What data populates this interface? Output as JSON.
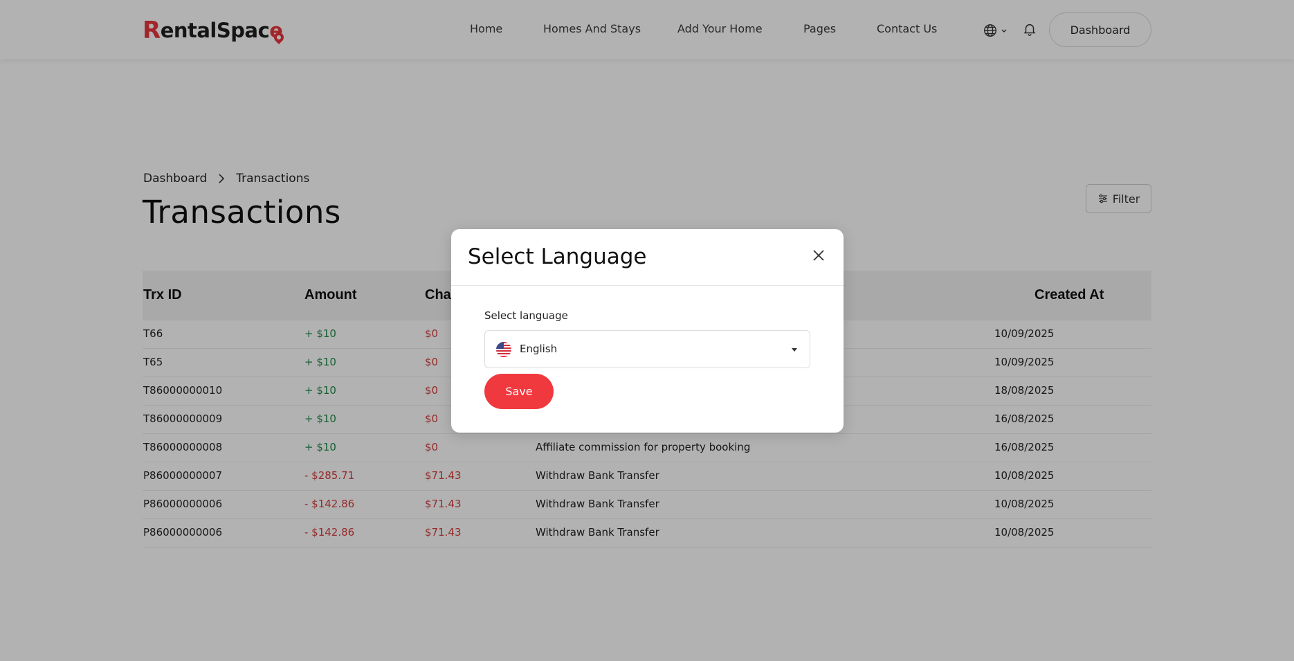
{
  "header": {
    "logo_first": "R",
    "logo_rest": "entalSpac",
    "logo_last": "e",
    "nav": [
      "Home",
      "Homes And Stays",
      "Add Your Home",
      "Pages",
      "Contact Us"
    ],
    "dashboard_label": "Dashboard"
  },
  "breadcrumb": {
    "root": "Dashboard",
    "current": "Transactions"
  },
  "page": {
    "title": "Transactions",
    "filter_label": "Filter"
  },
  "table": {
    "headers": {
      "trx_id": "Trx ID",
      "amount": "Amount",
      "charge": "Cha",
      "created_at": "Created At"
    },
    "rows": [
      {
        "trx": "T66",
        "amount": "+ $10",
        "amount_type": "credit",
        "charge": "$0",
        "detail": "",
        "date": "10/09/2025"
      },
      {
        "trx": "T65",
        "amount": "+ $10",
        "amount_type": "credit",
        "charge": "$0",
        "detail": "",
        "date": "10/09/2025"
      },
      {
        "trx": "T86000000010",
        "amount": "+ $10",
        "amount_type": "credit",
        "charge": "$0",
        "detail": "",
        "date": "18/08/2025"
      },
      {
        "trx": "T86000000009",
        "amount": "+ $10",
        "amount_type": "credit",
        "charge": "$0",
        "detail": "",
        "date": "16/08/2025"
      },
      {
        "trx": "T86000000008",
        "amount": "+ $10",
        "amount_type": "credit",
        "charge": "$0",
        "detail": "Affiliate commission for property booking",
        "date": "16/08/2025"
      },
      {
        "trx": "P86000000007",
        "amount": "- $285.71",
        "amount_type": "debit",
        "charge": "$71.43",
        "detail": "Withdraw Bank Transfer",
        "date": "10/08/2025"
      },
      {
        "trx": "P86000000006",
        "amount": "- $142.86",
        "amount_type": "debit",
        "charge": "$71.43",
        "detail": "Withdraw Bank Transfer",
        "date": "10/08/2025"
      },
      {
        "trx": "P86000000006",
        "amount": "- $142.86",
        "amount_type": "debit",
        "charge": "$71.43",
        "detail": "Withdraw Bank Transfer",
        "date": "10/08/2025"
      }
    ]
  },
  "modal": {
    "title": "Select Language",
    "field_label": "Select language",
    "selected_language": "English",
    "save_label": "Save"
  },
  "colors": {
    "accent": "#f0393f",
    "credit": "#1e8a4a",
    "debit": "#d63c3c"
  },
  "icons": {
    "language": "globe-icon",
    "notifications": "bell-icon",
    "filter": "sliders-icon",
    "close": "close-icon",
    "breadcrumb_sep": "chevron-right-icon",
    "flag": "us-flag-icon"
  }
}
